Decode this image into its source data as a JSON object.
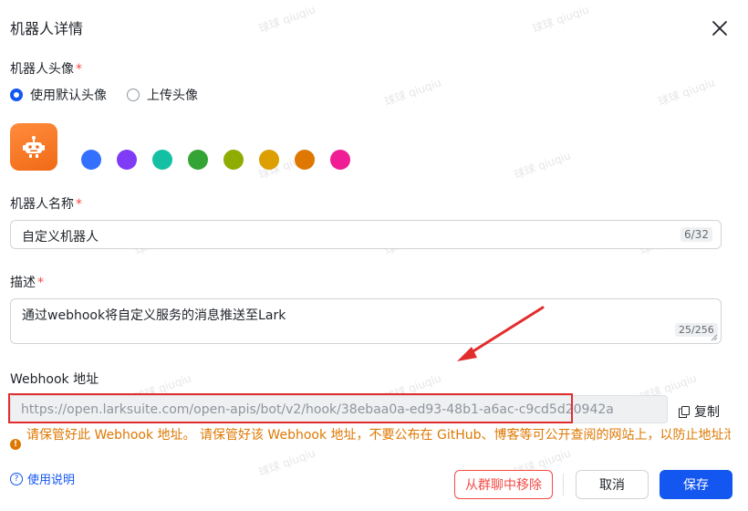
{
  "dialog": {
    "title": "机器人详情"
  },
  "avatar_section": {
    "label": "机器人头像",
    "required_mark": "*",
    "radio_default": "使用默认头像",
    "radio_upload": "上传头像",
    "selected": "default",
    "swatch_colors": [
      "#3370ff",
      "#7f3bf5",
      "#14c0a3",
      "#34a434",
      "#8fac02",
      "#dd9e00",
      "#de7802",
      "#f01d94"
    ]
  },
  "name_section": {
    "label": "机器人名称",
    "required_mark": "*",
    "value": "自定义机器人",
    "counter": "6/32"
  },
  "description_section": {
    "label": "描述",
    "required_mark": "*",
    "value": "通过webhook将自定义服务的消息推送至Lark",
    "counter": "25/256"
  },
  "webhook_section": {
    "label": "Webhook 地址",
    "url": "https://open.larksuite.com/open-apis/bot/v2/hook/38ebaa0a-ed93-48b1-a6ac-c9cd5d20942a",
    "copy_label": "复制",
    "warning": "请保管好此 Webhook 地址。 请保管好该 Webhook 地址，不要公布在 GitHub、博客等可公开查阅的网站上，以防止地址泄"
  },
  "footer": {
    "help_label": "使用说明",
    "remove_label": "从群聊中移除",
    "cancel_label": "取消",
    "save_label": "保存"
  },
  "watermark": "球球 qiuqiu",
  "colors": {
    "primary": "#1456f0",
    "danger": "#f54a45",
    "warning": "#de7802",
    "annotation": "#e22d2d"
  }
}
